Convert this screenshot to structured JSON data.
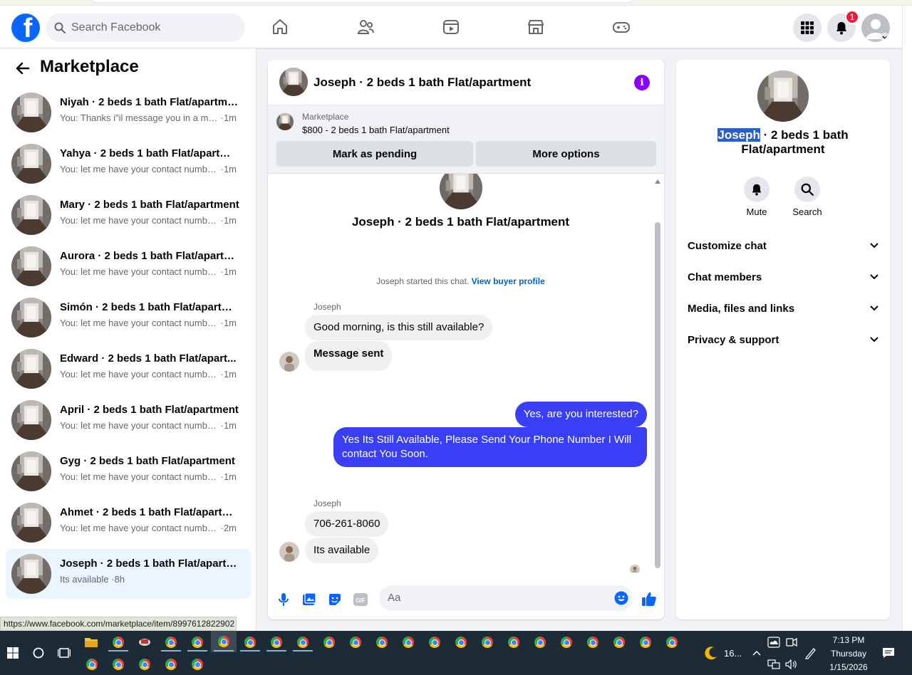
{
  "header": {
    "search_placeholder": "Search Facebook",
    "notification_count": "1",
    "brand_color": "#0866ff"
  },
  "sidebar": {
    "title": "Marketplace",
    "conversations": [
      {
        "name": "Niyah · 2 beds 1 bath Flat/apartment",
        "message": "You: Thanks i\"il message you in a mo...",
        "time": "1m"
      },
      {
        "name": "Yahya · 2 beds 1 bath Flat/apartment",
        "message": "You: let me have your contact numbe...",
        "time": "1m"
      },
      {
        "name": "Mary · 2 beds 1 bath Flat/apartment",
        "message": "You: let me have your contact numbe...",
        "time": "1m"
      },
      {
        "name": "Aurora · 2 beds 1 bath Flat/apartm...",
        "message": "You: let me have your contact numbe...",
        "time": "1m"
      },
      {
        "name": "Simón · 2 beds 1 bath Flat/apartm...",
        "message": "You: let me have your contact numbe...",
        "time": "1m"
      },
      {
        "name": "Edward · 2 beds 1 bath Flat/apart...",
        "message": "You: let me have your contact numbe...",
        "time": "1m"
      },
      {
        "name": "April · 2 beds 1 bath Flat/apartment",
        "message": "You: let me have your contact numbe...",
        "time": "1m"
      },
      {
        "name": "Gyg · 2 beds 1 bath Flat/apartment",
        "message": "You: let me have your contact numbe...",
        "time": "1m"
      },
      {
        "name": "Ahmet · 2 beds 1 bath Flat/apartm...",
        "message": "You: let me have your contact numbe...",
        "time": "2m"
      },
      {
        "name": "Joseph · 2 beds 1 bath Flat/apartm...",
        "message": "Its available",
        "time": "8h"
      }
    ],
    "status_url": "https://www.facebook.com/marketplace/item/8997612822902"
  },
  "chat": {
    "title": "Joseph · 2 beds 1 bath Flat/apartment",
    "marketplace_label": "Marketplace",
    "listing": "$800 - 2 beds 1 bath Flat/apartment",
    "mark_pending": "Mark as pending",
    "more_options": "More options",
    "intro_title": "Joseph · 2 beds 1 bath Flat/apartment",
    "started_text": "Joseph started this chat.",
    "view_profile": "View buyer profile",
    "sender1": "Joseph",
    "msg1": "Good morning, is this still available?",
    "msg2": "Message sent",
    "msg3": "Yes, are you interested?",
    "msg4_line1": "Yes Its Still Available, Please Send Your Phone Number I Will",
    "msg4_line2": "contact You Soon.",
    "sender2": "Joseph",
    "msg5": "706-261-8060",
    "msg6": "Its available",
    "composer_placeholder": "Aa",
    "accent_color": "#3a3ff5"
  },
  "info": {
    "name_highlight": "Joseph",
    "name_rest": " · 2 beds 1 bath",
    "name_line2": "Flat/apartment",
    "mute": "Mute",
    "search": "Search",
    "sections": [
      "Customize chat",
      "Chat members",
      "Media, files and links",
      "Privacy & support"
    ]
  },
  "taskbar": {
    "weather": "16...",
    "time": "7:13 PM",
    "day": "Thursday",
    "date": "1/15/2026"
  }
}
